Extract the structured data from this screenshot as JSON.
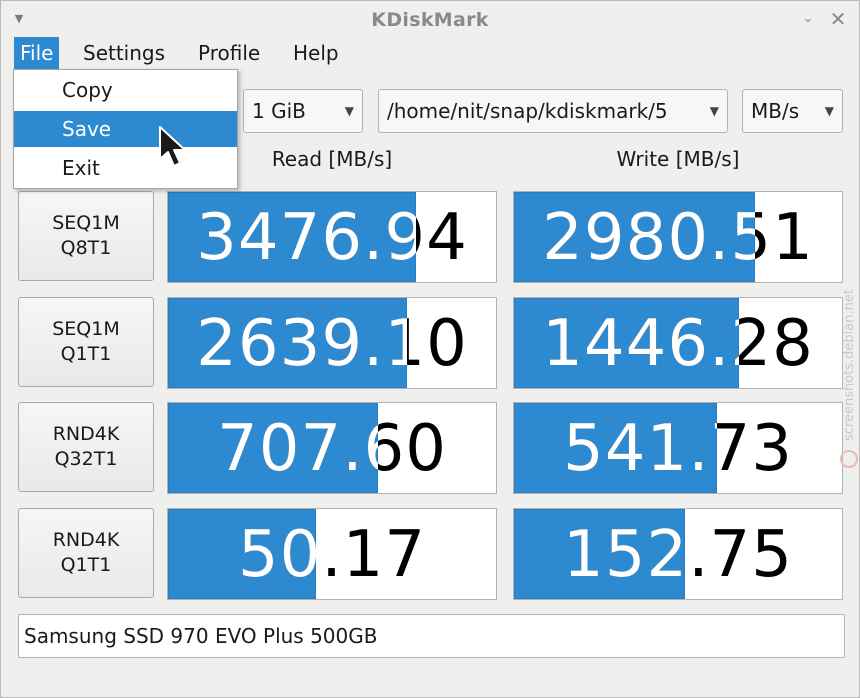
{
  "window": {
    "title": "KDiskMark"
  },
  "menubar": [
    {
      "label": "File",
      "active": true
    },
    {
      "label": "Settings",
      "active": false
    },
    {
      "label": "Profile",
      "active": false
    },
    {
      "label": "Help",
      "active": false
    }
  ],
  "file_menu": [
    {
      "label": "Copy",
      "highlight": false
    },
    {
      "label": "Save",
      "highlight": true
    },
    {
      "label": "Exit",
      "highlight": false
    }
  ],
  "controls": {
    "size": "1 GiB",
    "path": "/home/nit/snap/kdiskmark/5",
    "unit": "MB/s"
  },
  "headers": {
    "read": "Read [MB/s]",
    "write": "Write [MB/s]"
  },
  "tests": [
    {
      "line1": "SEQ1M",
      "line2": "Q8T1",
      "read": "3476.94",
      "write": "2980.51",
      "read_fill": 0.755,
      "write_fill": 0.735
    },
    {
      "line1": "SEQ1M",
      "line2": "Q1T1",
      "read": "2639.10",
      "write": "1446.28",
      "read_fill": 0.73,
      "write_fill": 0.685
    },
    {
      "line1": "RND4K",
      "line2": "Q32T1",
      "read": "707.60",
      "write": "541.73",
      "read_fill": 0.64,
      "write_fill": 0.618
    },
    {
      "line1": "RND4K",
      "line2": "Q1T1",
      "read": "50.17",
      "write": "152.75",
      "read_fill": 0.45,
      "write_fill": 0.52
    }
  ],
  "device": "Samsung SSD 970 EVO Plus 500GB",
  "watermark": "screenshots.debian.net",
  "colors": {
    "accent": "#2e8ad0",
    "bar_fill": "#2e8ad0"
  }
}
